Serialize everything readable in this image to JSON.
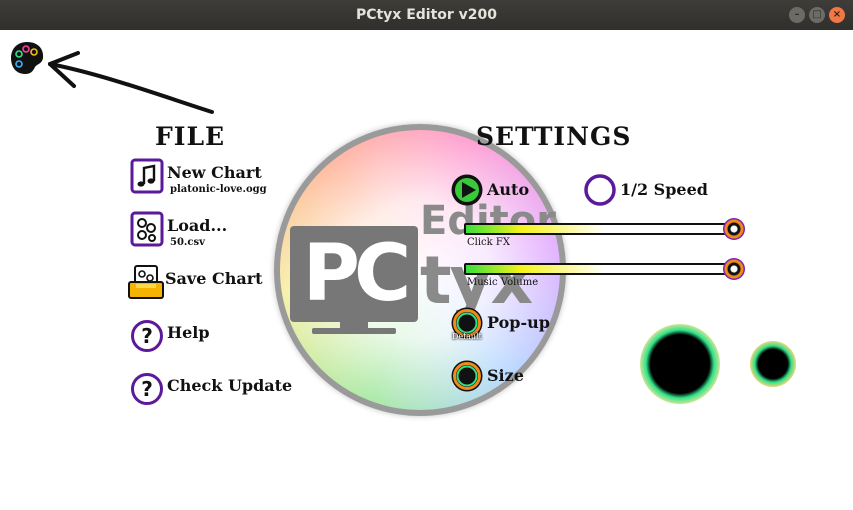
{
  "window": {
    "title": "PCtyx Editor v200",
    "buttons": {
      "minimize": "–",
      "maximize": "□",
      "close": "×"
    }
  },
  "logo": {
    "pc": "PC",
    "editor": "Editor",
    "tyx": "tyx"
  },
  "file": {
    "heading": "FILE",
    "new_chart": {
      "label": "New Chart",
      "sub": "platonic-love.ogg",
      "icon": "music-note-icon"
    },
    "load": {
      "label": "Load...",
      "sub": "50.csv",
      "icon": "notes-folder-icon"
    },
    "save": {
      "label": "Save Chart",
      "icon": "save-tray-icon"
    },
    "help": {
      "label": "Help",
      "icon": "help-icon"
    },
    "update": {
      "label": "Check Update",
      "icon": "help-icon"
    }
  },
  "settings": {
    "heading": "SETTINGS",
    "auto_label": "Auto",
    "half_speed_label": "1/2 Speed",
    "click_fx_label": "Click FX",
    "music_volume_label": "Music Volume",
    "click_fx_level": 0.9,
    "music_volume_level": 0.9,
    "popup_label": "Pop-up",
    "popup_sub": "Default",
    "size_label": "Size"
  },
  "colors": {
    "accent_purple": "#5a1a9a",
    "play_green": "#3ac93a",
    "ring_orange": "#f08a1a",
    "ring_green": "#2ee38a"
  }
}
